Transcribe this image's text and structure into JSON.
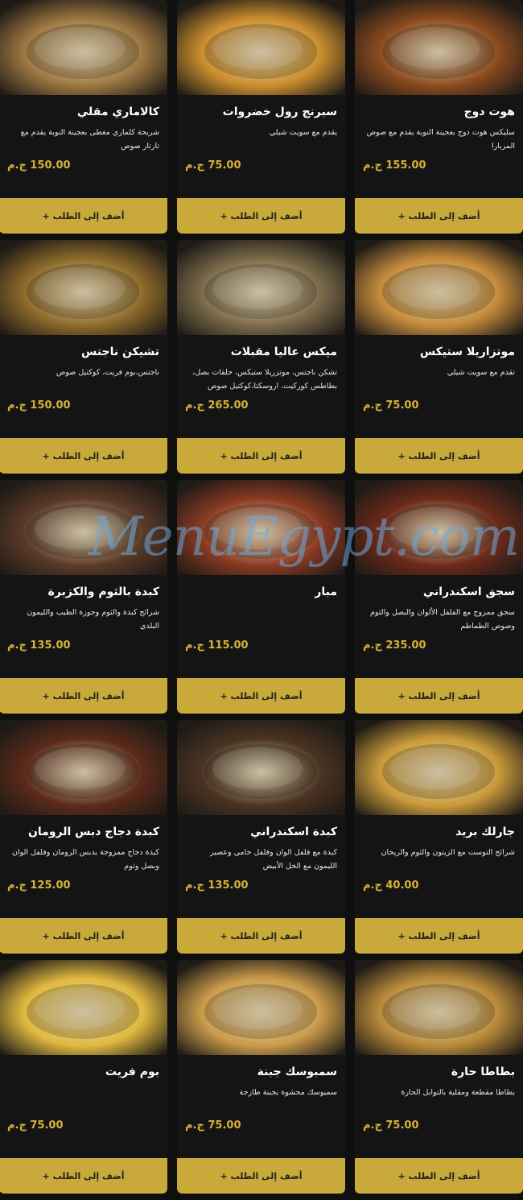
{
  "button_label": "أضف إلى الطلب +",
  "watermark": "MenuEgypt.com",
  "items": [
    {
      "title": "هوت دوج",
      "desc": "سليكس هوت دوج بعجينة النوبة يقدم مع صوص المربارا",
      "price": "155.00 ج.م",
      "icon": "sausage-rolls",
      "color": "#8a4a1e"
    },
    {
      "title": "سبرنج رول خضروات",
      "desc": "يقدم مع سويت شيلي",
      "price": "75.00 ج.م",
      "icon": "spring-rolls",
      "color": "#c98d2e"
    },
    {
      "title": "كالاماري مقلي",
      "desc": "شريحة كلماري مغطى بعجينة النوبة يقدم مع تارتار صوص",
      "price": "150.00 ج.م",
      "icon": "fried-calamari",
      "color": "#9b7640"
    },
    {
      "title": "موتزاريلا ستيكس",
      "desc": "تقدم مع سويت شيلي",
      "price": "75.00 ج.م",
      "icon": "mozzarella-sticks",
      "color": "#c38a3b"
    },
    {
      "title": "ميكس عاليا مقبلات",
      "desc": "تشكن ناجتس، موتزريلا ستيكس، حلقات بصل، بطاطس كوركيت، اروسكتا،كوكتيل صوص",
      "price": "265.00 ج.م",
      "icon": "appetizer-mix",
      "color": "#7a6a4a"
    },
    {
      "title": "تشيكن ناجتس",
      "desc": "ناجتس،بوم فريت، كوكتيل صوص",
      "price": "150.00 ج.م",
      "icon": "chicken-nuggets",
      "color": "#8c6a2a"
    },
    {
      "title": "سجق اسكندراني",
      "desc": "سجق ممزوج مع الفلفل الألوان والبصل والثوم وصوص الطماطم",
      "price": "235.00 ج.م",
      "icon": "sausage-pan",
      "color": "#6b2a1a"
    },
    {
      "title": "مبار",
      "desc": "",
      "price": "115.00 ج.م",
      "icon": "mumbar",
      "color": "#8a3a22"
    },
    {
      "title": "كبدة بالثوم والكزبرة",
      "desc": "شرائح كبدة والثوم وجوزة الطيب والليمون البلدي",
      "price": "135.00 ج.م",
      "icon": "liver-garlic",
      "color": "#5a3a28"
    },
    {
      "title": "جارلك بريد",
      "desc": "شرائح التوست مع الزيتون والثوم والريحان",
      "price": "40.00 ج.م",
      "icon": "garlic-bread",
      "color": "#c89a3a"
    },
    {
      "title": "كبدة اسكندراني",
      "desc": "كبدة مع فلفل الوان وفلفل حامي وعصير الليمون مع الخل الأبيض",
      "price": "135.00 ج.م",
      "icon": "alexandrian-liver",
      "color": "#4a3322"
    },
    {
      "title": "كبدة دجاج دبس الرومان",
      "desc": "كبدة دجاج ممزوجة بدبس الرومان وفلفل الوان وبصل وثوم",
      "price": "125.00 ج.م",
      "icon": "chicken-liver",
      "color": "#5a2a1a"
    },
    {
      "title": "بطاطا حارة",
      "desc": "بطاطا مقطعة ومقلية بالتوابل الحارة",
      "price": "75.00 ج.م",
      "icon": "spicy-potatoes",
      "color": "#b88a3a"
    },
    {
      "title": "سمبوسك جبنة",
      "desc": "سمبوسك محشوة بجبنة طازجة",
      "price": "75.00 ج.م",
      "icon": "cheese-sambousek",
      "color": "#c99a4a"
    },
    {
      "title": "بوم فريت",
      "desc": "",
      "price": "75.00 ج.م",
      "icon": "french-fries",
      "color": "#e0b840"
    }
  ]
}
